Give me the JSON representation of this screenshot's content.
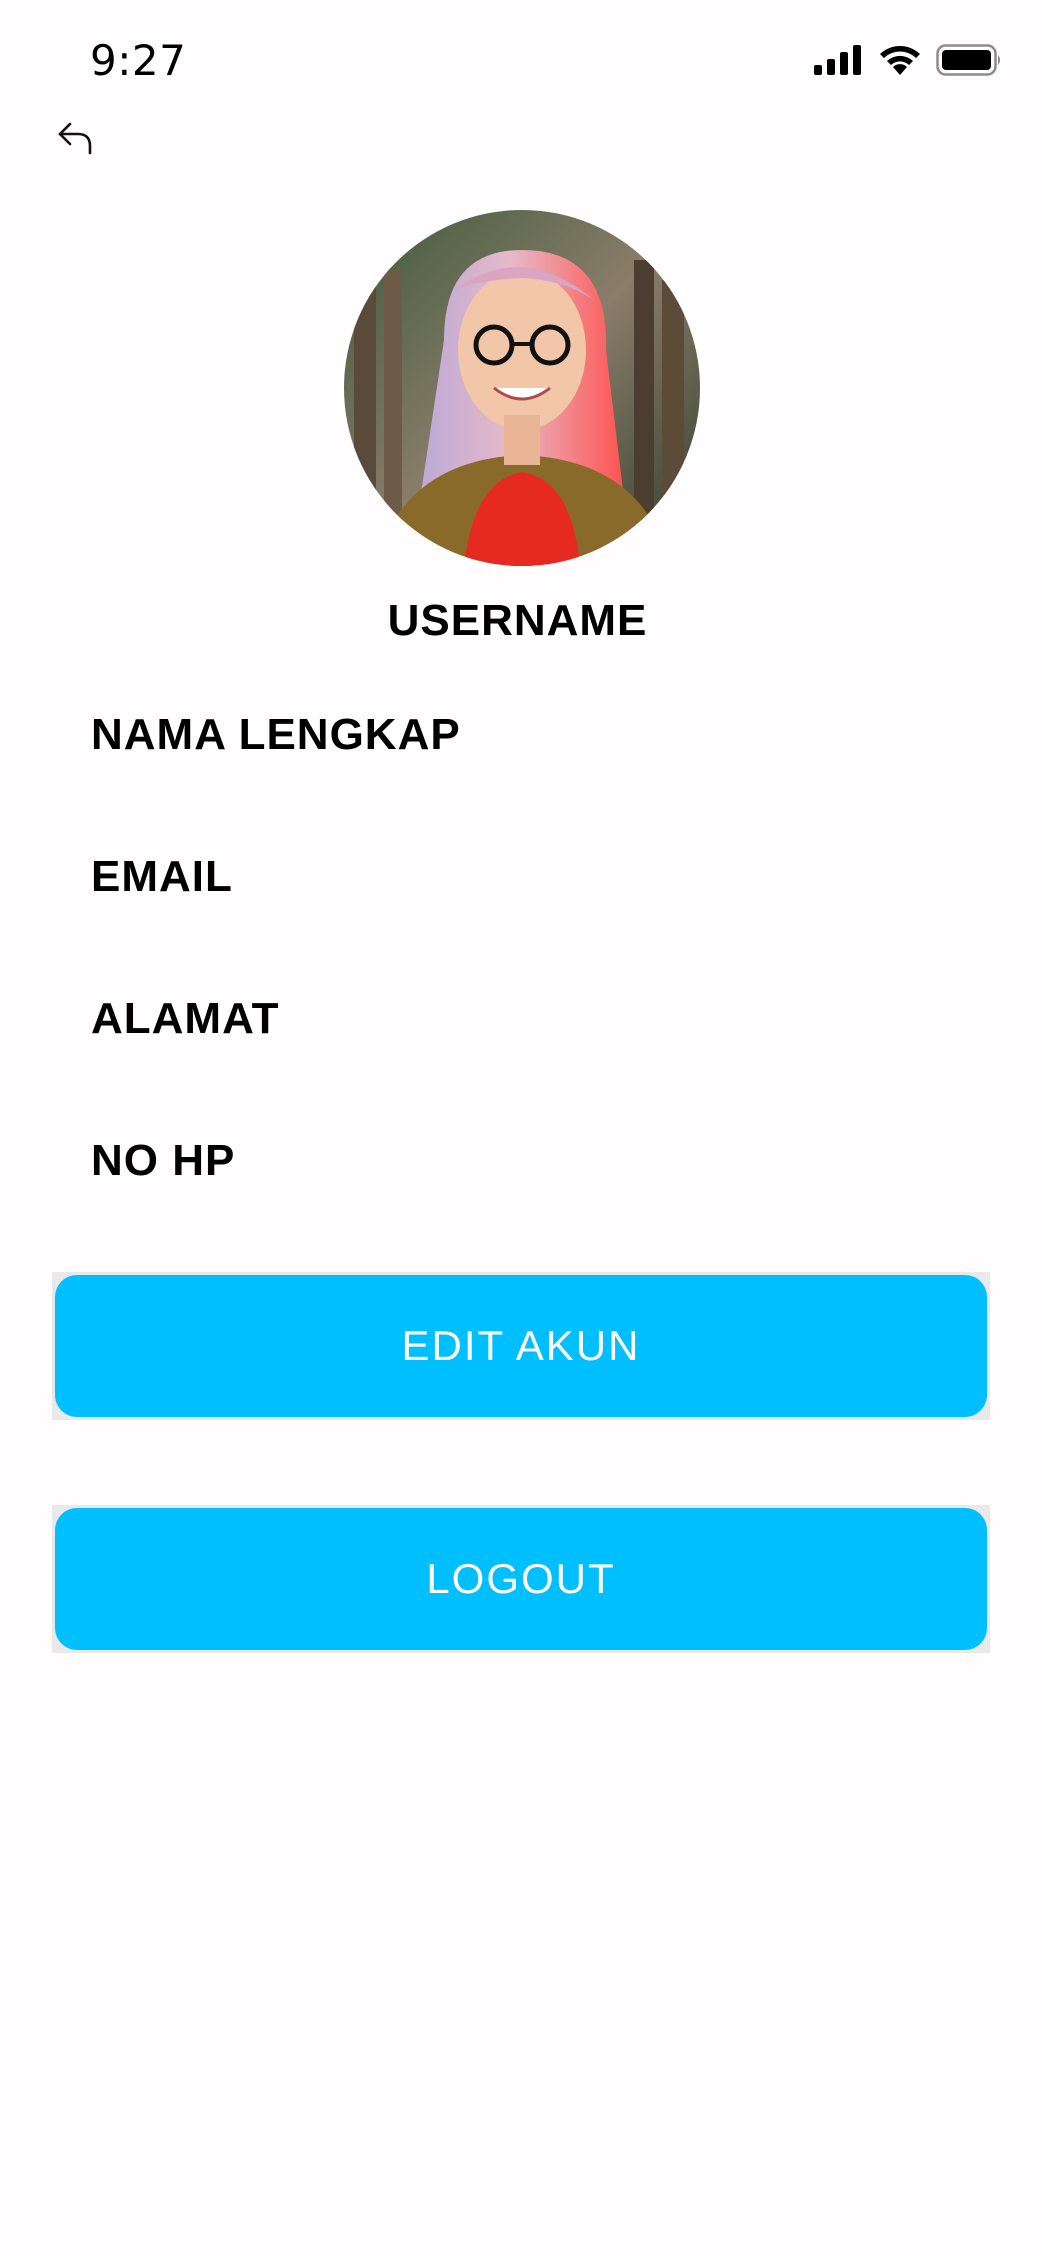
{
  "status_bar": {
    "time": "9:27",
    "icons": [
      "signal-icon",
      "wifi-icon",
      "battery-icon"
    ]
  },
  "nav": {
    "back_icon": "back-arrow-icon"
  },
  "profile": {
    "avatar": "profile-photo",
    "username": "USERNAME",
    "fields": [
      {
        "label": "NAMA LENGKAP"
      },
      {
        "label": "EMAIL"
      },
      {
        "label": "ALAMAT"
      },
      {
        "label": "NO HP"
      }
    ]
  },
  "actions": {
    "edit_label": "EDIT AKUN",
    "logout_label": "LOGOUT"
  },
  "colors": {
    "accent": "#00bfff",
    "background": "#fffdfd",
    "button_text": "#ffffff"
  }
}
